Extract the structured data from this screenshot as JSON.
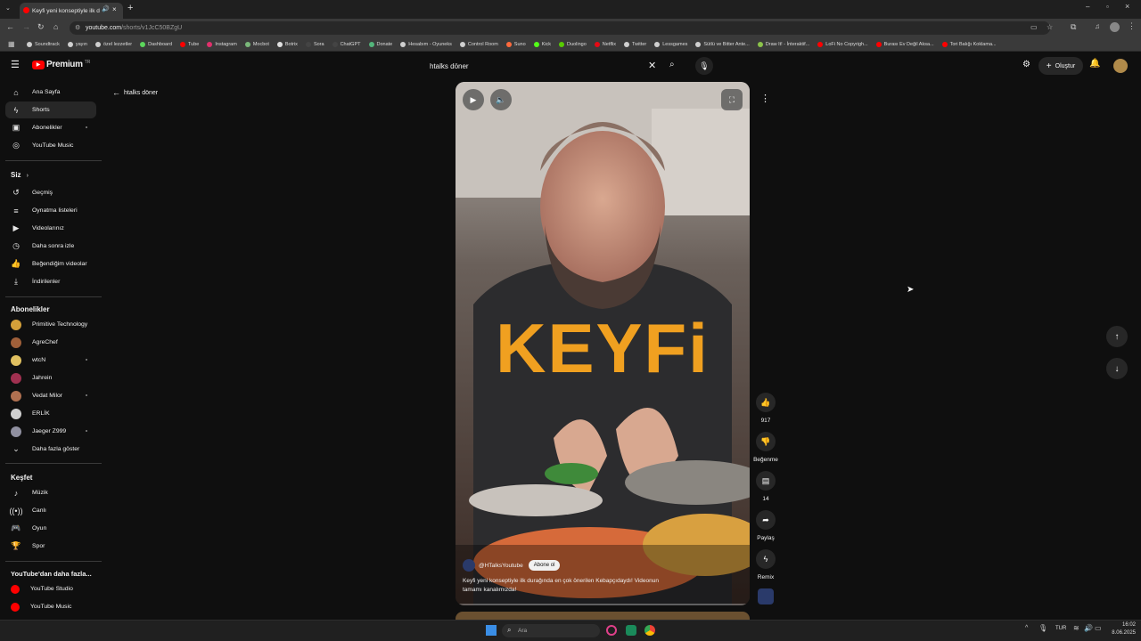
{
  "browser": {
    "tab_title": "Keyfi yeni konseptiyle ilk d",
    "url_host": "youtube.com",
    "url_path": "/shorts/v1JcC50BZgU",
    "bookmarks": [
      {
        "label": "Soundtrack",
        "color": "#cfcfcf"
      },
      {
        "label": "yayın",
        "color": "#cfcfcf"
      },
      {
        "label": "özel lezzetler",
        "color": "#cfcfcf"
      },
      {
        "label": "Dashboard",
        "color": "#5cd65c"
      },
      {
        "label": "Tube",
        "color": "#ff0000"
      },
      {
        "label": "Instagram",
        "color": "#e1306c"
      },
      {
        "label": "Mocbot",
        "color": "#7ab87a"
      },
      {
        "label": "Botrix",
        "color": "#e0e0e0"
      },
      {
        "label": "Sora",
        "color": "#444444"
      },
      {
        "label": "ChatGPT",
        "color": "#444444"
      },
      {
        "label": "Donate",
        "color": "#53b57b"
      },
      {
        "label": "Hesabım - Oyuneks",
        "color": "#cfcfcf"
      },
      {
        "label": "Control Room",
        "color": "#cfcfcf"
      },
      {
        "label": "Suno",
        "color": "#ff6a3d"
      },
      {
        "label": "Kick",
        "color": "#53fc18"
      },
      {
        "label": "Duolingo",
        "color": "#58cc02"
      },
      {
        "label": "Netflix",
        "color": "#e50914"
      },
      {
        "label": "Twitter",
        "color": "#cfcfcf"
      },
      {
        "label": "Lessgames",
        "color": "#cfcfcf"
      },
      {
        "label": "Sütlü ve Bitter Ante...",
        "color": "#cfcfcf"
      },
      {
        "label": "Draw It! - İnteraktif...",
        "color": "#8bc34a"
      },
      {
        "label": "LoFi No Copyrigh...",
        "color": "#ff0000"
      },
      {
        "label": "Burası Ev Değil Aksa...",
        "color": "#ff0000"
      },
      {
        "label": "Tori Balığı Koklama...",
        "color": "#ff0000"
      }
    ]
  },
  "header": {
    "logo_text": "Premium",
    "logo_sup": "TR",
    "search_value": "htalks döner",
    "create_label": "Oluştur"
  },
  "sidebar": {
    "main": [
      {
        "label": "Ana Sayfa",
        "icon": "home-icon"
      },
      {
        "label": "Shorts",
        "icon": "shorts-icon"
      },
      {
        "label": "Abonelikler",
        "icon": "subscriptions-icon"
      },
      {
        "label": "YouTube Music",
        "icon": "music-icon"
      }
    ],
    "you_title": "Siz",
    "you": [
      {
        "label": "Geçmiş"
      },
      {
        "label": "Oynatma listeleri"
      },
      {
        "label": "Videolarınız"
      },
      {
        "label": "Daha sonra izle"
      },
      {
        "label": "Beğendiğim videolar"
      },
      {
        "label": "İndirilenler"
      }
    ],
    "subs_title": "Abonelikler",
    "subs": [
      {
        "label": "Primitive Technology",
        "color": "#d4a03a"
      },
      {
        "label": "AgreChef",
        "color": "#a0603a"
      },
      {
        "label": "wtcN",
        "color": "#e0c060"
      },
      {
        "label": "Jahrein",
        "color": "#a03050"
      },
      {
        "label": "Vedat Milor",
        "color": "#b07050"
      },
      {
        "label": "ERLİK",
        "color": "#d0d0d0"
      },
      {
        "label": "Jaeger Z999",
        "color": "#9090a0"
      }
    ],
    "show_more": "Daha fazla göster",
    "explore_title": "Keşfet",
    "explore": [
      {
        "label": "Müzik"
      },
      {
        "label": "Canlı"
      },
      {
        "label": "Oyun"
      },
      {
        "label": "Spor"
      }
    ],
    "more_title": "YouTube'dan daha fazla...",
    "more": [
      {
        "label": "YouTube Studio"
      },
      {
        "label": "YouTube Music"
      }
    ]
  },
  "back_label": "htalks döner",
  "video": {
    "overlay_text": "KEYFi",
    "channel": "@HTalksYoutube",
    "subscribe": "Abone ol",
    "caption": "Keyfi yeni konseptiyle ilk durağında en çok önerilen Kebapçıdaydı! Videonun tamamı kanalımızda!"
  },
  "actions": {
    "likes": "917",
    "dislike": "Beğenme",
    "comments": "14",
    "share": "Paylaş",
    "remix": "Remix"
  },
  "taskbar": {
    "search_placeholder": "Ara",
    "lang": "TUR",
    "time": "16:02",
    "date": "8.06.2025"
  }
}
